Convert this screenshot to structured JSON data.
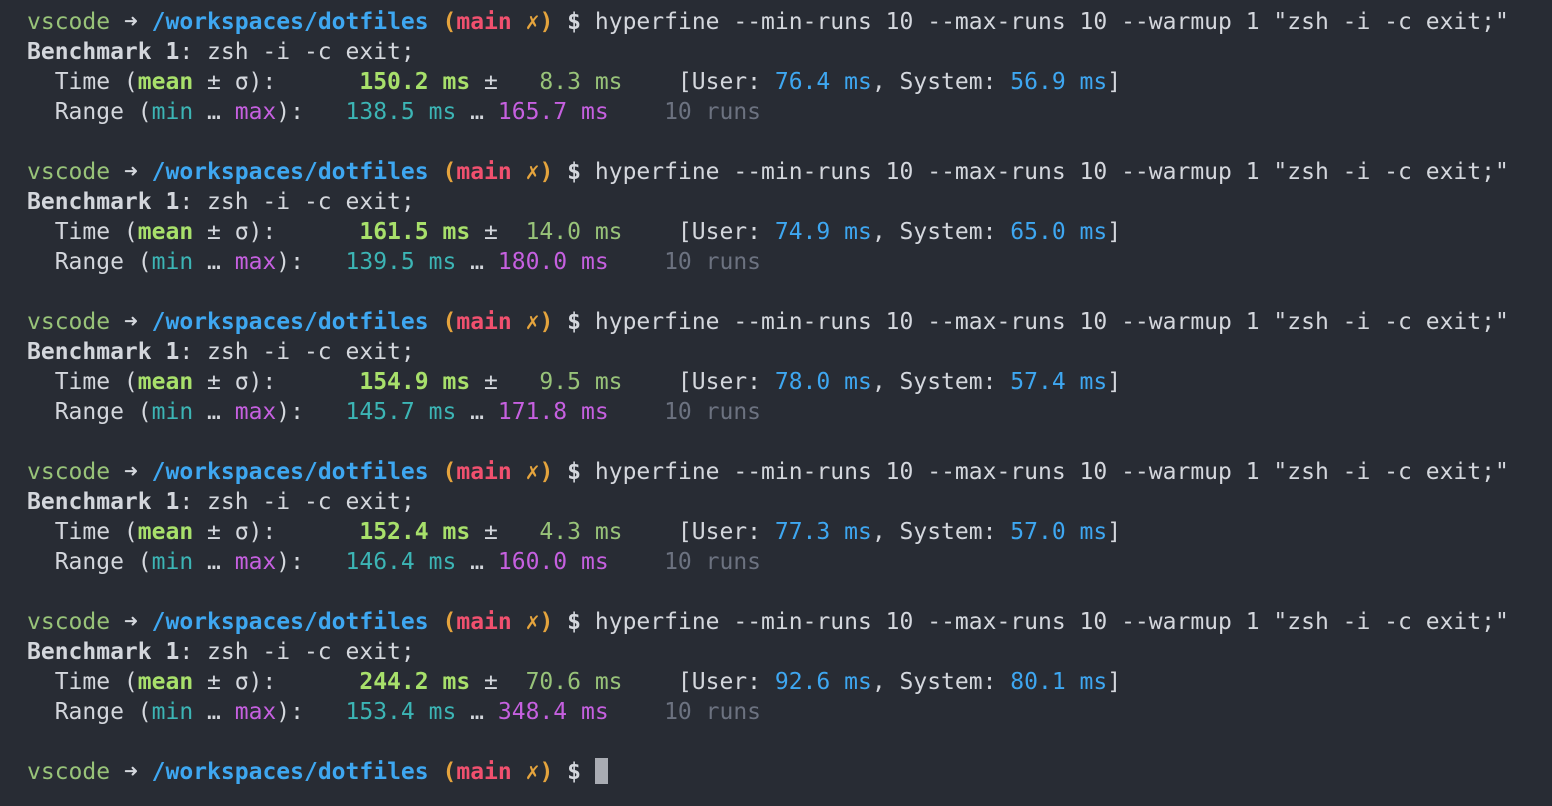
{
  "prompt": {
    "user": "vscode",
    "arrow": "➜",
    "path": "/workspaces/dotfiles",
    "open_paren": "(",
    "branch": "main",
    "dirty": "✗",
    "close_paren": ")",
    "dollar": "$"
  },
  "command": "hyperfine --min-runs 10 --max-runs 10 --warmup 1 \"zsh -i -c exit;\"",
  "labels": {
    "benchmark": "Benchmark 1",
    "benchmark_colon": ":",
    "benchmark_cmd": " zsh -i -c exit;",
    "time_prefix": "  Time (",
    "mean": "mean",
    "pm_sigma": " ± σ):",
    "range_prefix": "  Range (",
    "min": "min",
    "ellipsis": " … ",
    "max": "max",
    "range_suffix": "):",
    "pm": " ±",
    "user": "[User: ",
    "system": ", System: ",
    "close_bracket": "]",
    "unit": "ms",
    "runs": "10 runs"
  },
  "benchmarks": [
    {
      "mean": "150.2",
      "sigma": "8.3",
      "user": "76.4",
      "system": "56.9",
      "min": "138.5",
      "max": "165.7"
    },
    {
      "mean": "161.5",
      "sigma": "14.0",
      "user": "74.9",
      "system": "65.0",
      "min": "139.5",
      "max": "180.0"
    },
    {
      "mean": "154.9",
      "sigma": "9.5",
      "user": "78.0",
      "system": "57.4",
      "min": "145.7",
      "max": "171.8"
    },
    {
      "mean": "152.4",
      "sigma": "4.3",
      "user": "77.3",
      "system": "57.0",
      "min": "146.4",
      "max": "160.0"
    },
    {
      "mean": "244.2",
      "sigma": "70.6",
      "user": "92.6",
      "system": "80.1",
      "min": "153.4",
      "max": "348.4"
    }
  ],
  "colors": {
    "background": "#282c34",
    "user": "#98c379",
    "path": "#3ea7f1",
    "branch": "#f0506e",
    "dirty": "#e5a43d",
    "mean": "#a8e06b",
    "min": "#3cb5b5",
    "max": "#c660e0",
    "runs": "#6c7280"
  }
}
